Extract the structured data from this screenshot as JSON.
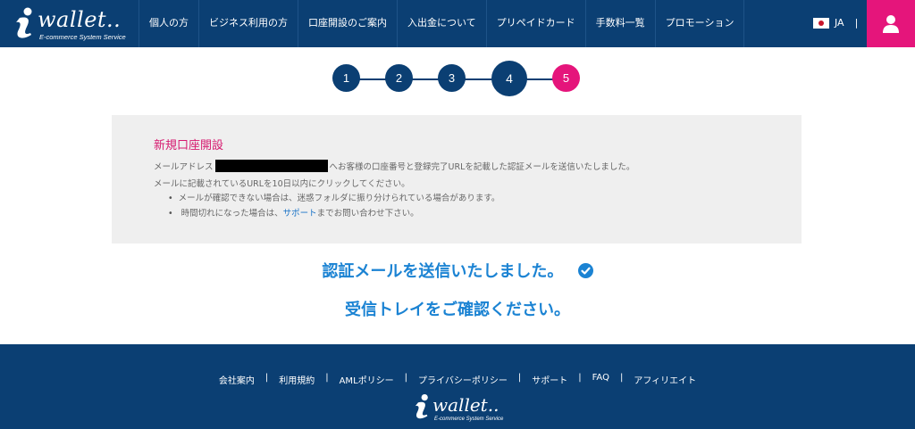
{
  "header": {
    "logo_text": "wallet..",
    "logo_tagline": "E-commerce System Service",
    "nav": [
      {
        "label": "個人の方"
      },
      {
        "label": "ビジネス利用の方"
      },
      {
        "label": "口座開設のご案内"
      },
      {
        "label": "入出金について"
      },
      {
        "label": "プリペイドカード"
      },
      {
        "label": "手数料一覧"
      },
      {
        "label": "プロモーション"
      }
    ],
    "lang": "JA",
    "lang_sep": "|",
    "user_icon": "user-icon"
  },
  "steps": {
    "items": [
      "1",
      "2",
      "3",
      "4",
      "5"
    ],
    "current": "4",
    "colors": {
      "default": "#0b3f73",
      "highlight": "#e5157b"
    }
  },
  "box": {
    "title": "新規口座開設",
    "line1_prefix": "メールアドレス",
    "line1_suffix": "へお客様の口座番号と登録完了URLを記載した認証メールを送信いたしました。",
    "line2": "メールに記載されているURLを10日以内にクリックしてください。",
    "bullet1": "メールが確認できない場合は、迷惑フォルダに振り分けられている場合があります。",
    "bullet2_prefix": "時間切れになった場合は、",
    "bullet2_link": "サポート",
    "bullet2_suffix": "までお問い合わせ下さい。"
  },
  "confirm": {
    "line1": "認証メールを送信いたしました。",
    "line2": "受信トレイをご確認ください。",
    "icon": "check-circle-icon"
  },
  "footer": {
    "links": [
      {
        "label": "会社案内"
      },
      {
        "label": "利用規約"
      },
      {
        "label": "AMLポリシー"
      },
      {
        "label": "プライバシーポリシー"
      },
      {
        "label": "サポート"
      },
      {
        "label": "FAQ"
      },
      {
        "label": "アフィリエイト"
      }
    ],
    "separator": "|",
    "logo_text": "wallet..",
    "logo_tagline": "E-commerce System Service"
  },
  "colors": {
    "primary": "#0b3f73",
    "accent": "#e5157b",
    "message": "#1b83d3"
  }
}
